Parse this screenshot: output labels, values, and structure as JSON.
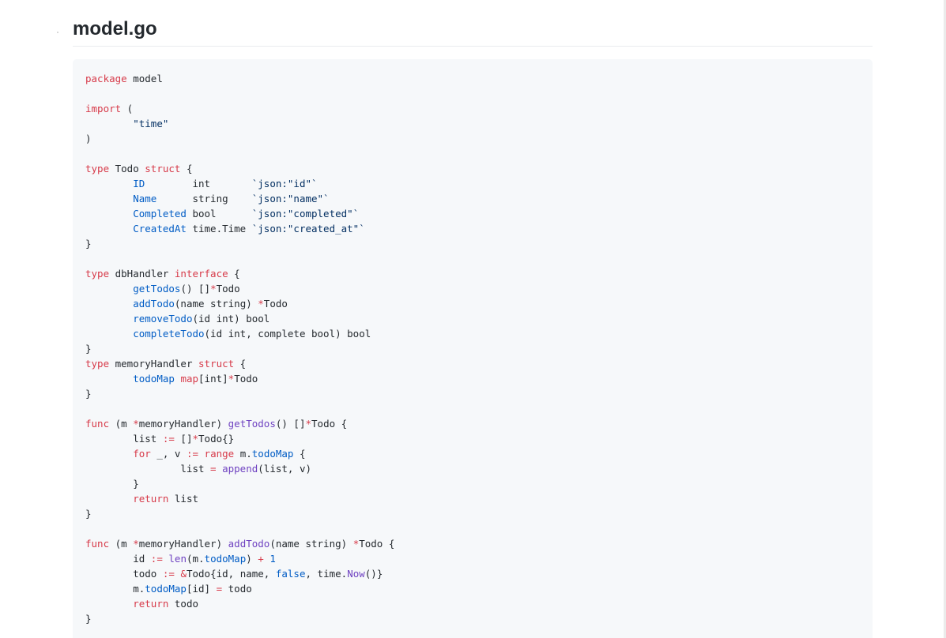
{
  "page": {
    "title": "model.go"
  },
  "code": {
    "language": "go",
    "lines": [
      [
        {
          "t": "package",
          "c": "kw"
        },
        {
          "t": " model"
        }
      ],
      [],
      [
        {
          "t": "import",
          "c": "kw"
        },
        {
          "t": " ("
        }
      ],
      [
        {
          "t": "        "
        },
        {
          "t": "\"time\"",
          "c": "str"
        }
      ],
      [
        {
          "t": ")"
        }
      ],
      [],
      [
        {
          "t": "type",
          "c": "kw"
        },
        {
          "t": " Todo "
        },
        {
          "t": "struct",
          "c": "kw"
        },
        {
          "t": " {"
        }
      ],
      [
        {
          "t": "        "
        },
        {
          "t": "ID",
          "c": "fld"
        },
        {
          "t": "        int       "
        },
        {
          "t": "`json:\"id\"`",
          "c": "tag"
        }
      ],
      [
        {
          "t": "        "
        },
        {
          "t": "Name",
          "c": "fld"
        },
        {
          "t": "      string    "
        },
        {
          "t": "`json:\"name\"`",
          "c": "tag"
        }
      ],
      [
        {
          "t": "        "
        },
        {
          "t": "Completed",
          "c": "fld"
        },
        {
          "t": " bool      "
        },
        {
          "t": "`json:\"completed\"`",
          "c": "tag"
        }
      ],
      [
        {
          "t": "        "
        },
        {
          "t": "CreatedAt",
          "c": "fld"
        },
        {
          "t": " time.Time "
        },
        {
          "t": "`json:\"created_at\"`",
          "c": "tag"
        }
      ],
      [
        {
          "t": "}"
        }
      ],
      [],
      [
        {
          "t": "type",
          "c": "kw"
        },
        {
          "t": " dbHandler "
        },
        {
          "t": "interface",
          "c": "kw"
        },
        {
          "t": " {"
        }
      ],
      [
        {
          "t": "        "
        },
        {
          "t": "getTodos",
          "c": "fld"
        },
        {
          "t": "() []"
        },
        {
          "t": "*",
          "c": "op"
        },
        {
          "t": "Todo"
        }
      ],
      [
        {
          "t": "        "
        },
        {
          "t": "addTodo",
          "c": "fld"
        },
        {
          "t": "(name string) "
        },
        {
          "t": "*",
          "c": "op"
        },
        {
          "t": "Todo"
        }
      ],
      [
        {
          "t": "        "
        },
        {
          "t": "removeTodo",
          "c": "fld"
        },
        {
          "t": "(id int) bool"
        }
      ],
      [
        {
          "t": "        "
        },
        {
          "t": "completeTodo",
          "c": "fld"
        },
        {
          "t": "(id int, complete bool) bool"
        }
      ],
      [
        {
          "t": "}"
        }
      ],
      [
        {
          "t": "type",
          "c": "kw"
        },
        {
          "t": " memoryHandler "
        },
        {
          "t": "struct",
          "c": "kw"
        },
        {
          "t": " {"
        }
      ],
      [
        {
          "t": "        "
        },
        {
          "t": "todoMap",
          "c": "fld"
        },
        {
          "t": " "
        },
        {
          "t": "map",
          "c": "kw"
        },
        {
          "t": "[int]"
        },
        {
          "t": "*",
          "c": "op"
        },
        {
          "t": "Todo"
        }
      ],
      [
        {
          "t": "}"
        }
      ],
      [],
      [
        {
          "t": "func",
          "c": "kw"
        },
        {
          "t": " (m "
        },
        {
          "t": "*",
          "c": "op"
        },
        {
          "t": "memoryHandler) "
        },
        {
          "t": "getTodos",
          "c": "fn"
        },
        {
          "t": "() []"
        },
        {
          "t": "*",
          "c": "op"
        },
        {
          "t": "Todo {"
        }
      ],
      [
        {
          "t": "        list "
        },
        {
          "t": ":=",
          "c": "op"
        },
        {
          "t": " []"
        },
        {
          "t": "*",
          "c": "op"
        },
        {
          "t": "Todo{}"
        }
      ],
      [
        {
          "t": "        "
        },
        {
          "t": "for",
          "c": "kw"
        },
        {
          "t": " _, v "
        },
        {
          "t": ":=",
          "c": "op"
        },
        {
          "t": " "
        },
        {
          "t": "range",
          "c": "kw"
        },
        {
          "t": " m."
        },
        {
          "t": "todoMap",
          "c": "fld"
        },
        {
          "t": " {"
        }
      ],
      [
        {
          "t": "                list "
        },
        {
          "t": "=",
          "c": "op"
        },
        {
          "t": " "
        },
        {
          "t": "append",
          "c": "fn"
        },
        {
          "t": "(list, v)"
        }
      ],
      [
        {
          "t": "        }"
        }
      ],
      [
        {
          "t": "        "
        },
        {
          "t": "return",
          "c": "kw"
        },
        {
          "t": " list"
        }
      ],
      [
        {
          "t": "}"
        }
      ],
      [],
      [
        {
          "t": "func",
          "c": "kw"
        },
        {
          "t": " (m "
        },
        {
          "t": "*",
          "c": "op"
        },
        {
          "t": "memoryHandler) "
        },
        {
          "t": "addTodo",
          "c": "fn"
        },
        {
          "t": "(name string) "
        },
        {
          "t": "*",
          "c": "op"
        },
        {
          "t": "Todo {"
        }
      ],
      [
        {
          "t": "        id "
        },
        {
          "t": ":=",
          "c": "op"
        },
        {
          "t": " "
        },
        {
          "t": "len",
          "c": "fn"
        },
        {
          "t": "(m."
        },
        {
          "t": "todoMap",
          "c": "fld"
        },
        {
          "t": ") "
        },
        {
          "t": "+",
          "c": "op"
        },
        {
          "t": " "
        },
        {
          "t": "1",
          "c": "num"
        }
      ],
      [
        {
          "t": "        todo "
        },
        {
          "t": ":=",
          "c": "op"
        },
        {
          "t": " "
        },
        {
          "t": "&",
          "c": "op"
        },
        {
          "t": "Todo{id, name, "
        },
        {
          "t": "false",
          "c": "num"
        },
        {
          "t": ", time."
        },
        {
          "t": "Now",
          "c": "fn"
        },
        {
          "t": "()}"
        }
      ],
      [
        {
          "t": "        m."
        },
        {
          "t": "todoMap",
          "c": "fld"
        },
        {
          "t": "[id] "
        },
        {
          "t": "=",
          "c": "op"
        },
        {
          "t": " todo"
        }
      ],
      [
        {
          "t": "        "
        },
        {
          "t": "return",
          "c": "kw"
        },
        {
          "t": " todo"
        }
      ],
      [
        {
          "t": "}"
        }
      ]
    ]
  }
}
